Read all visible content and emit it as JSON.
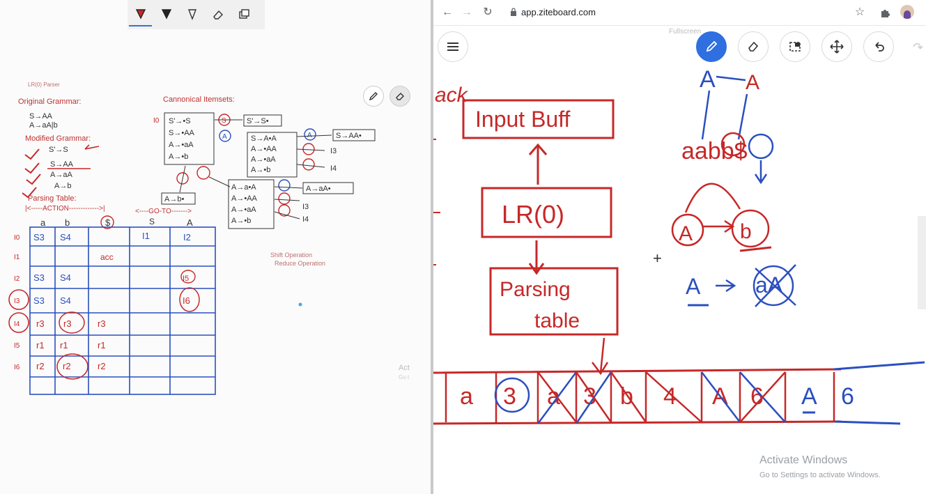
{
  "left_toolbar": {
    "tools": [
      "pen-red",
      "pen-black",
      "highlighter",
      "eraser",
      "layers"
    ]
  },
  "notes": {
    "header": "LR(0) Parser",
    "original_grammar_title": "Original Grammar:",
    "original_rules": [
      "S→AA",
      "A→aA|b"
    ],
    "modified_grammar_title": "Modified Grammar:",
    "modified_rules": [
      "S'→S",
      "S→AA",
      "A→aA",
      "A→b"
    ],
    "canonical_title": "Cannonical Itemsets:",
    "parsing_table_title": "Parsing Table:",
    "action_label": "|<-----ACTION------------->|",
    "goto_label": "<----GO-TO------->",
    "shift_note": "Shift Operation",
    "reduce_note": "Reduce Operation",
    "faded_text_1": "Act",
    "faded_text_2": "Go t"
  },
  "itemsets": {
    "I0": [
      "S'→•S",
      "S→•AA",
      "A→•aA",
      "A→•b"
    ],
    "I1": "S'→S•",
    "I2": [
      "S→A•A",
      "A→•AA",
      "A→•aA",
      "A→•b"
    ],
    "I3": [
      "A→a•A",
      "A→•AA",
      "A→•aA",
      "A→•b"
    ],
    "I4": "A→b•",
    "I5": "S→AA•",
    "I6": "A→aA•"
  },
  "parsing_table": {
    "headers": [
      "a",
      "b",
      "$",
      "S",
      "A"
    ],
    "rows": [
      {
        "state": "I0",
        "cells": [
          "S3",
          "S4",
          "",
          "I1",
          "I2"
        ]
      },
      {
        "state": "I1",
        "cells": [
          "",
          "",
          "acc",
          "",
          ""
        ]
      },
      {
        "state": "I2",
        "cells": [
          "S3",
          "S4",
          "",
          "",
          "I5"
        ]
      },
      {
        "state": "I3",
        "cells": [
          "S3",
          "S4",
          "",
          "",
          "I6"
        ]
      },
      {
        "state": "I4",
        "cells": [
          "r3",
          "r3",
          "r3",
          "",
          ""
        ]
      },
      {
        "state": "I5",
        "cells": [
          "r1",
          "r1",
          "r1",
          "",
          ""
        ]
      },
      {
        "state": "I6",
        "cells": [
          "r2",
          "r2",
          "r2",
          "",
          ""
        ]
      }
    ]
  },
  "browser": {
    "url": "app.ziteboard.com",
    "fullscreen_hint": "Fullscreen"
  },
  "whiteboard": {
    "fragment_top": "ack",
    "input_buffer": "Input Buff",
    "lr0": "LR(0)",
    "parsing_table_1": "Parsing",
    "parsing_table_2": "table",
    "top_A1": "A",
    "top_A2": "A",
    "input_string": "aabb$",
    "dfa_left": "A",
    "dfa_right": "b",
    "production_left": "A",
    "production_right": "aA",
    "stack_cells": [
      "a",
      "3",
      "a",
      "3",
      "b",
      "4",
      "A",
      "6",
      "A",
      "6"
    ]
  },
  "watermark": {
    "line1": "Activate Windows",
    "line2": "Go to Settings to activate Windows."
  }
}
